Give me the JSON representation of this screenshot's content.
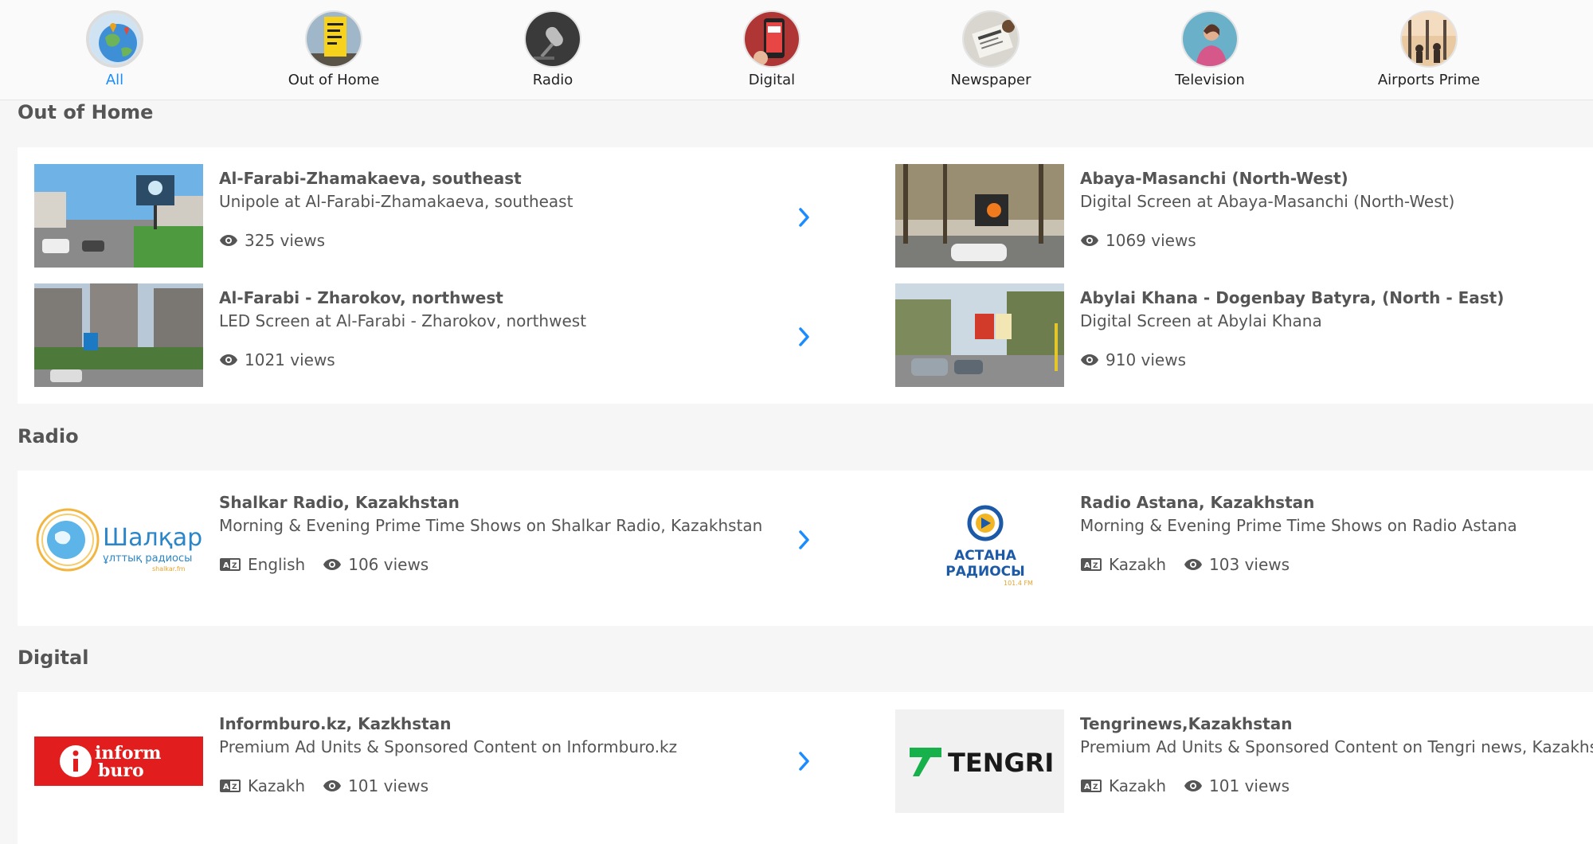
{
  "nav": {
    "accent": "#1a8cff",
    "categories": [
      {
        "label": "All",
        "icon": "globe-icon",
        "active": true
      },
      {
        "label": "Out of Home",
        "icon": "billboard-icon",
        "active": false
      },
      {
        "label": "Radio",
        "icon": "microphone-icon",
        "active": false
      },
      {
        "label": "Digital",
        "icon": "smartphone-icon",
        "active": false
      },
      {
        "label": "Newspaper",
        "icon": "newspaper-icon",
        "active": false
      },
      {
        "label": "Television",
        "icon": "television-icon",
        "active": false
      },
      {
        "label": "Airports Prime",
        "icon": "airport-icon",
        "active": false
      }
    ]
  },
  "sections": {
    "ooh": {
      "title": "Out of Home",
      "items": [
        {
          "title": "Al-Farabi-Zhamakaeva, southeast",
          "subtitle": "Unipole at Al-Farabi-Zhamakaeva, southeast",
          "views": "325 views"
        },
        {
          "title": "Abaya-Masanchi (North-West)",
          "subtitle": "Digital Screen at Abaya-Masanchi (North-West)",
          "views": "1069 views"
        },
        {
          "title": "Al-Farabi - Zharokov, northwest",
          "subtitle": "LED Screen at Al-Farabi - Zharokov, northwest",
          "views": "1021 views"
        },
        {
          "title": "Abylai Khana - Dogenbay Batyra, (North - East)",
          "subtitle": "Digital Screen at Abylai Khana",
          "views": "910 views"
        }
      ]
    },
    "radio": {
      "title": "Radio",
      "items": [
        {
          "title": "Shalkar Radio, Kazakhstan",
          "subtitle": "Morning & Evening Prime Time Shows on Shalkar Radio, Kazakhstan",
          "language": "English",
          "views": "106 views",
          "logo_text": "Шалқар",
          "logo_sub": "ұлттық радиосы",
          "logo_small": "shalkar.fm"
        },
        {
          "title": "Radio Astana, Kazakhstan",
          "subtitle": "Morning & Evening Prime Time Shows on Radio Astana",
          "language": "Kazakh",
          "views": "103 views",
          "logo_text": "АСТАНА",
          "logo_sub": "РАДИОСЫ",
          "logo_small": "101.4 FM"
        }
      ]
    },
    "digital": {
      "title": "Digital",
      "items": [
        {
          "title": "Informburo.kz, Kazkhstan",
          "subtitle": "Premium Ad Units & Sponsored Content on Informburo.kz",
          "language": "Kazakh",
          "views": "101 views",
          "logo_text": "inform",
          "logo_sub": "buro"
        },
        {
          "title": "Tengrinews,Kazakhstan",
          "subtitle": "Premium Ad Units & Sponsored Content on Tengri news, Kazakhstan",
          "language": "Kazakh",
          "views": "101 views",
          "logo_text": "TENGRI"
        }
      ]
    }
  }
}
